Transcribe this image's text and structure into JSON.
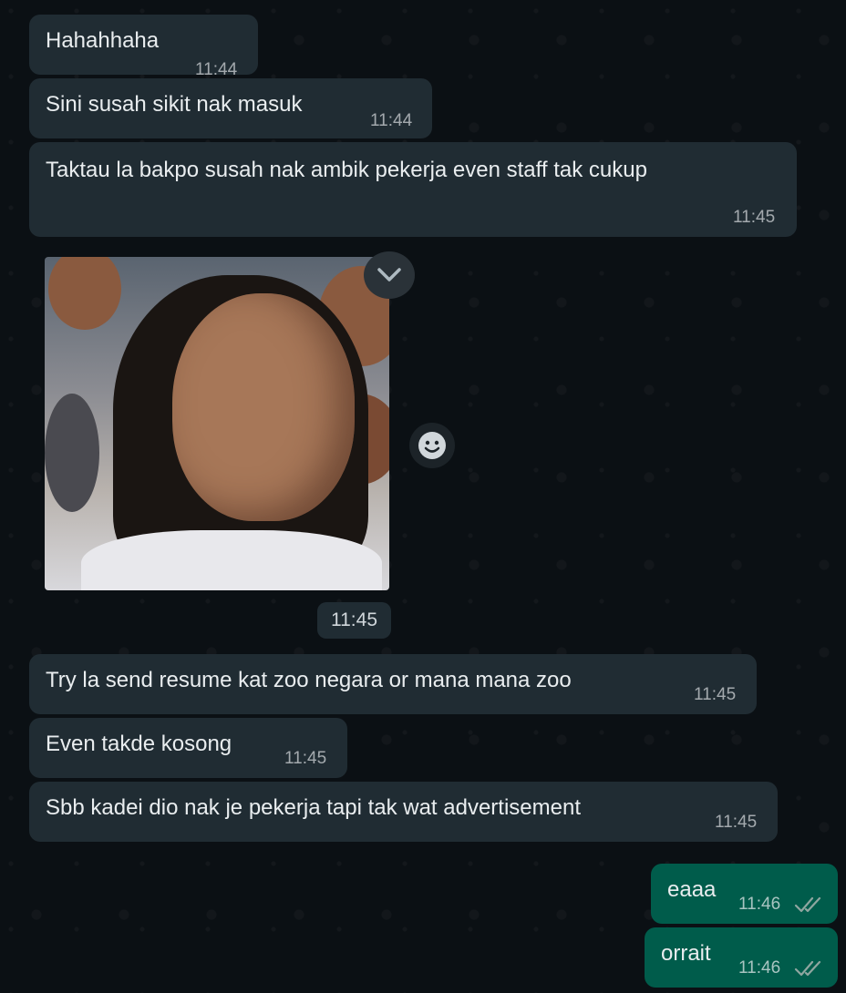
{
  "messages": [
    {
      "text": "Hahahhaha",
      "time": "11:44"
    },
    {
      "text": "Sini susah sikit nak masuk",
      "time": "11:44"
    },
    {
      "text": "Taktau la bakpo susah nak ambik pekerja even staff tak cukup",
      "time": "11:45"
    },
    {
      "media": "sticker-image",
      "time": "11:45"
    },
    {
      "text": "Try la send resume kat zoo negara or mana mana zoo",
      "time": "11:45"
    },
    {
      "text": "Even takde kosong",
      "time": "11:45"
    },
    {
      "text": "Sbb kadei dio nak je pekerja tapi tak wat advertisement",
      "time": "11:45"
    },
    {
      "text": "eaaa",
      "time": "11:46",
      "outgoing": true,
      "status": "read-double-tick-icon"
    },
    {
      "text": "orrait",
      "time": "11:46",
      "outgoing": true,
      "status": "read-double-tick-icon"
    }
  ],
  "colors": {
    "background": "#0b1014",
    "incoming_bubble": "#202c33",
    "outgoing_bubble": "#005c4b",
    "text": "#e9edef"
  },
  "icons": {
    "chevron": "chevron-down-icon",
    "react": "emoji-react-icon"
  }
}
